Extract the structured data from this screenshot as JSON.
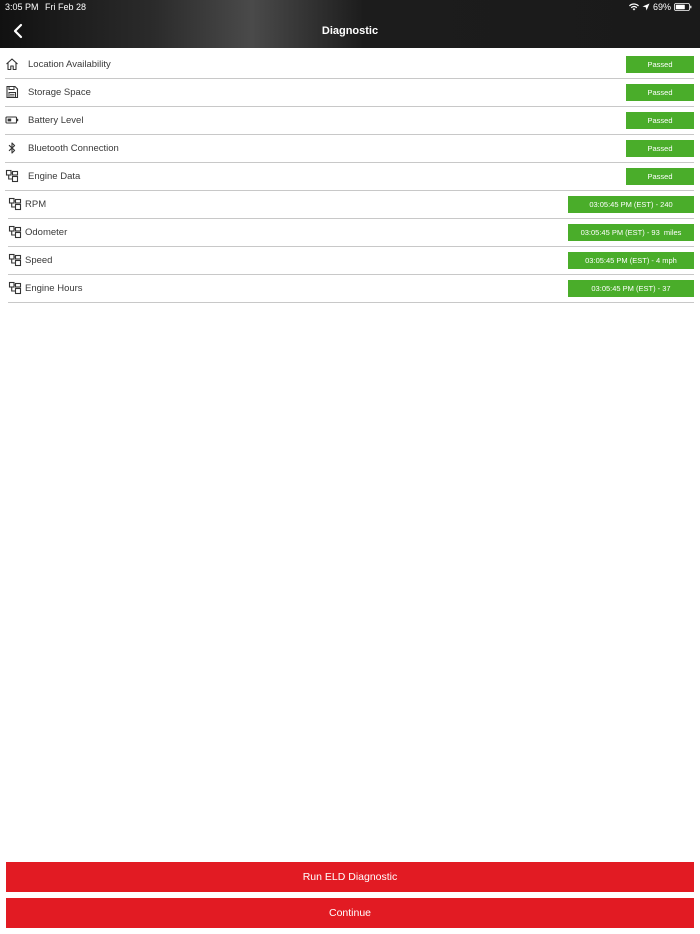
{
  "status_bar": {
    "time": "3:05 PM",
    "date": "Fri Feb 28",
    "battery": "69%"
  },
  "header": {
    "title": "Diagnostic"
  },
  "checks": [
    {
      "label": "Location Availability",
      "status": "Passed",
      "icon": "home-icon"
    },
    {
      "label": "Storage Space",
      "status": "Passed",
      "icon": "storage-icon"
    },
    {
      "label": "Battery Level",
      "status": "Passed",
      "icon": "battery-icon"
    },
    {
      "label": "Bluetooth Connection",
      "status": "Passed",
      "icon": "bluetooth-icon"
    },
    {
      "label": "Engine Data",
      "status": "Passed",
      "icon": "engine-data-icon"
    }
  ],
  "engine_data": [
    {
      "label": "RPM",
      "value": "03:05:45 PM (EST) - 240"
    },
    {
      "label": "Odometer",
      "value": "03:05:45 PM (EST) - 93  miles"
    },
    {
      "label": "Speed",
      "value": "03:05:45 PM (EST) - 4 mph"
    },
    {
      "label": "Engine Hours",
      "value": "03:05:45 PM (EST) - 37"
    }
  ],
  "buttons": {
    "run_label": "Run ELD Diagnostic",
    "continue_label": "Continue"
  },
  "colors": {
    "accent_red": "#e21b23",
    "pass_green": "#4aad2a"
  }
}
